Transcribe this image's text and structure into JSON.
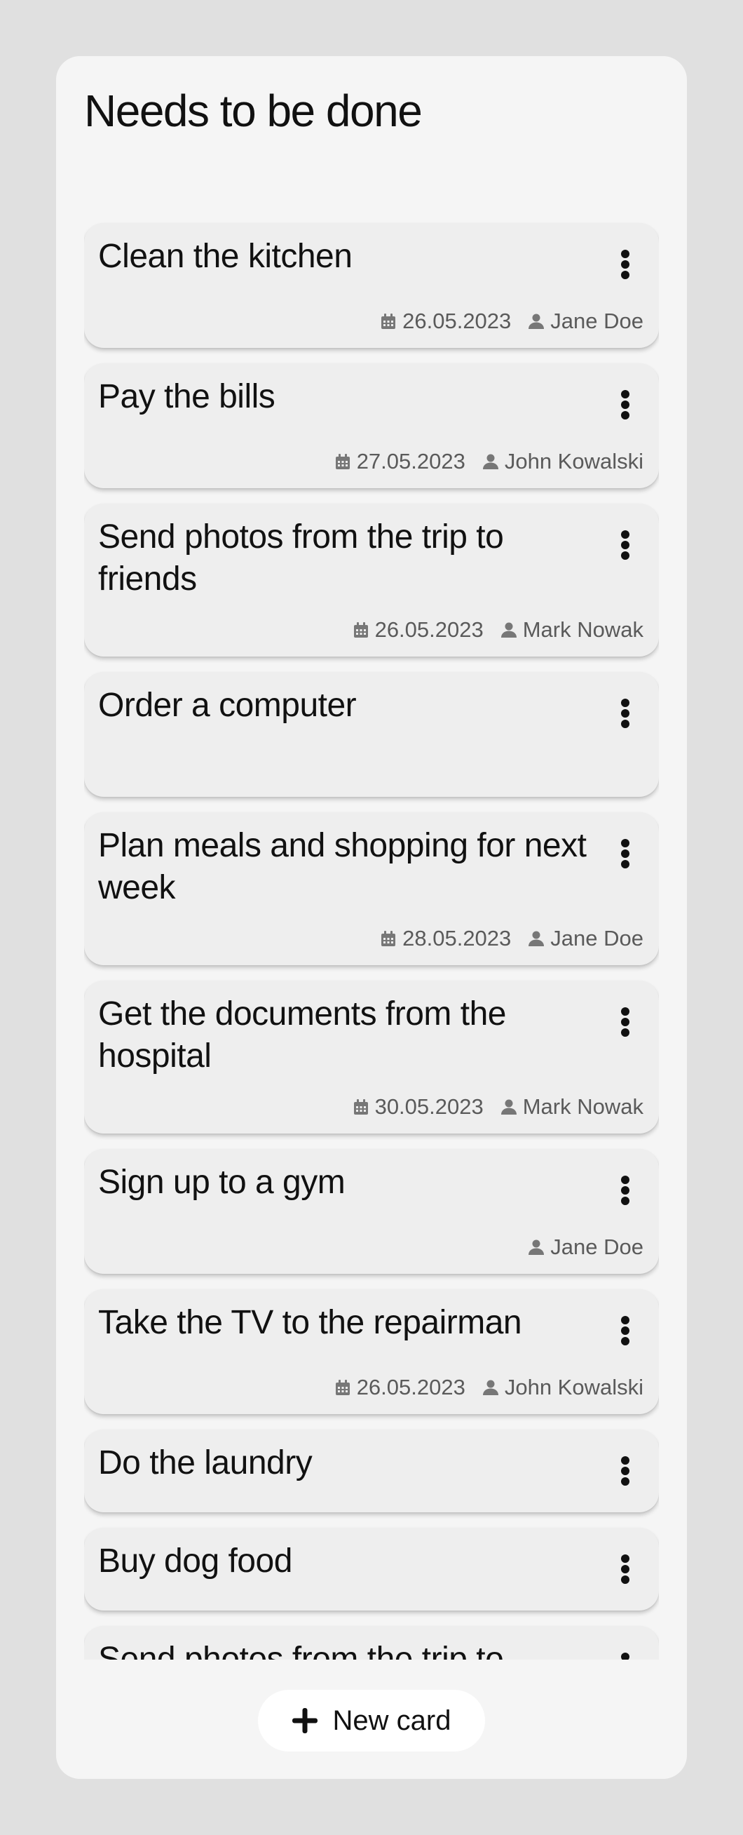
{
  "column": {
    "title": "Needs to be done"
  },
  "cards": [
    {
      "title": "Clean the kitchen",
      "date": "26.05.2023",
      "assignee": "Jane Doe"
    },
    {
      "title": "Pay the bills",
      "date": "27.05.2023",
      "assignee": "John Kowalski"
    },
    {
      "title": "Send photos from the trip to friends",
      "date": "26.05.2023",
      "assignee": "Mark Nowak"
    },
    {
      "title": "Order a computer",
      "date": null,
      "assignee": null
    },
    {
      "title": "Plan meals and shopping for next week",
      "date": "28.05.2023",
      "assignee": "Jane Doe"
    },
    {
      "title": "Get the documents from the hospital",
      "date": "30.05.2023",
      "assignee": "Mark Nowak"
    },
    {
      "title": "Sign up to a gym",
      "date": null,
      "assignee": "Jane Doe"
    },
    {
      "title": "Take the TV to the repairman",
      "date": "26.05.2023",
      "assignee": "John Kowalski"
    },
    {
      "title": "Do the laundry",
      "date": null,
      "assignee": null
    },
    {
      "title": "Buy dog food",
      "date": null,
      "assignee": null
    },
    {
      "title": "Send photos from the trip to friends",
      "date": null,
      "assignee": null
    }
  ],
  "icons": {
    "date": "calendar-icon",
    "assignee": "user-icon",
    "menu": "more-vertical-icon",
    "add": "plus-icon"
  },
  "actions": {
    "new_card_label": "New card"
  }
}
